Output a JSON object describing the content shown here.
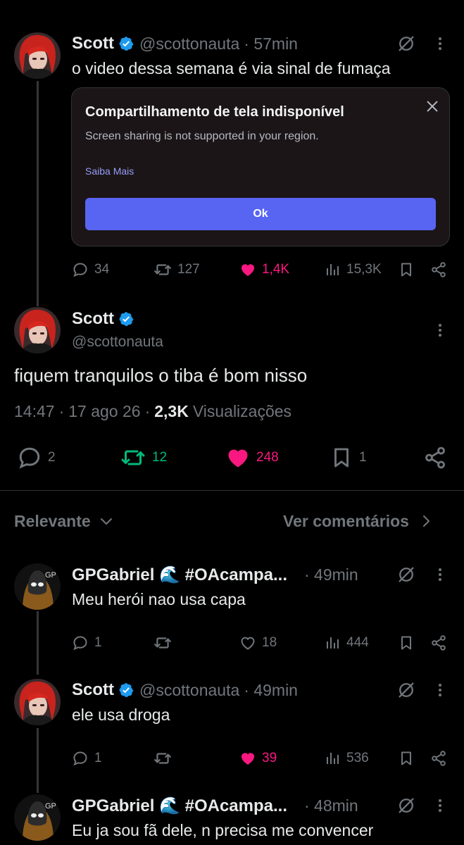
{
  "tweet1": {
    "name": "Scott",
    "handle": "@scottonauta",
    "time": "· 57min",
    "text": "o video dessa semana é via sinal de fumaça",
    "card": {
      "title": "Compartilhamento de tela indisponível",
      "subtitle": "Screen sharing is not supported in your region.",
      "link": "Saiba Mais",
      "button": "Ok"
    },
    "replies": "34",
    "retweets": "127",
    "likes": "1,4K",
    "views": "15,3K"
  },
  "main_tweet": {
    "name": "Scott",
    "handle": "@scottonauta",
    "text": "fiquem tranquilos o tiba é bom nisso",
    "time": "14:47",
    "date": "17 ago 26",
    "views_count": "2,3K",
    "views_label": "Visualizações",
    "replies": "2",
    "retweets": "12",
    "likes": "248",
    "bookmarks": "1"
  },
  "filter": {
    "sort_label": "Relevante",
    "see_replies": "Ver comentários"
  },
  "reply1": {
    "name": "GPGabriel 🌊 #OAcampa...",
    "time": "· 49min",
    "text": "Meu herói nao usa capa",
    "replies": "1",
    "likes": "18",
    "views": "444"
  },
  "reply2": {
    "name": "Scott",
    "handle": "@scottonauta",
    "time": "· 49min",
    "text": "ele usa droga",
    "replies": "1",
    "likes": "39",
    "views": "536"
  },
  "reply3": {
    "name": "GPGabriel 🌊 #OAcampa...",
    "time": "· 48min",
    "text": "Eu ja sou fã dele, n precisa me convencer"
  },
  "colors": {
    "accent_blue": "#1d9bf0",
    "like_pink": "#f91880",
    "retweet_green": "#00ba7c",
    "discord_blurple": "#5865f2"
  }
}
